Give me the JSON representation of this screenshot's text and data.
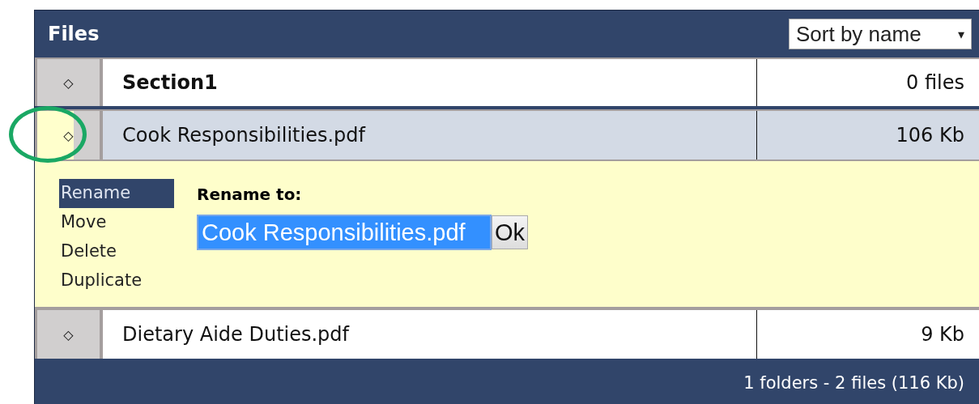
{
  "header": {
    "title": "Files",
    "sort": {
      "value": "Sort by name",
      "arrow": "▾"
    }
  },
  "rows": [
    {
      "kind": "folder",
      "handle": "◇",
      "name": "Section1",
      "size": "0 files",
      "selected": false,
      "highlighted": false
    },
    {
      "kind": "file",
      "handle": "◇",
      "name": "Cook Responsibilities.pdf",
      "size": "106 Kb",
      "selected": true,
      "highlighted": true,
      "actions": [
        {
          "label": "Rename",
          "selected": true
        },
        {
          "label": "Move",
          "selected": false
        },
        {
          "label": "Delete",
          "selected": false
        },
        {
          "label": "Duplicate",
          "selected": false
        }
      ],
      "rename": {
        "label": "Rename to:",
        "value": "Cook Responsibilities.pdf",
        "button": "Ok"
      }
    },
    {
      "kind": "file",
      "handle": "◇",
      "name": "Dietary Aide Duties.pdf",
      "size": "9 Kb",
      "selected": false,
      "highlighted": false
    }
  ],
  "footer": {
    "summary": "1 folders - 2 files (116 Kb)"
  }
}
